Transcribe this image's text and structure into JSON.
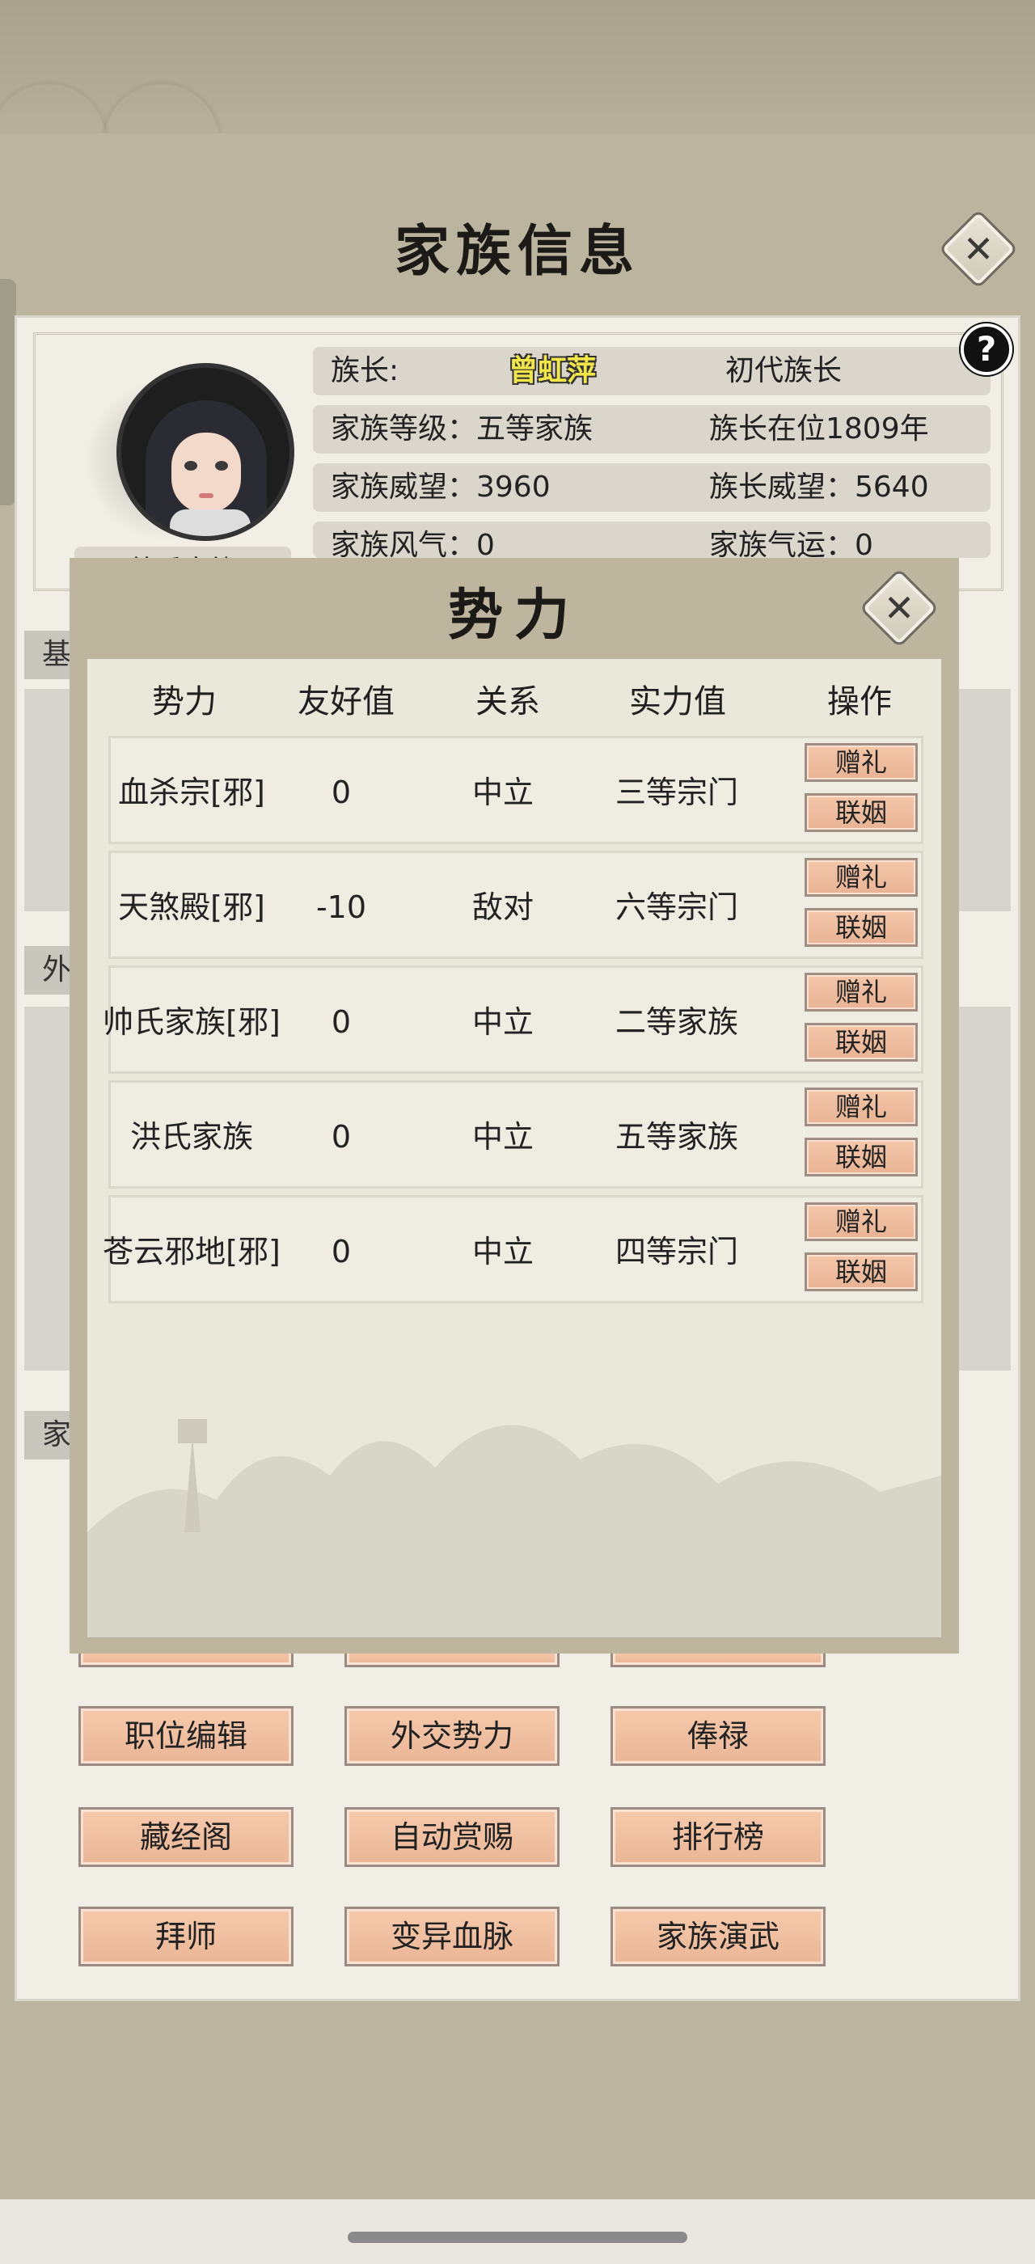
{
  "page": {
    "title": "家族信息",
    "close_icon": "close-icon"
  },
  "family": {
    "chief_label": "族长:",
    "chief_name": "曾虹萍",
    "chief_generation": "初代族长",
    "level": "家族等级：五等家族",
    "tenure": "族长在位1809年",
    "family_prestige": "家族威望：3960",
    "chief_prestige": "族长威望：5640",
    "family_style": "家族风气：0",
    "family_fortune": "家族气运：0",
    "name_plate": "曾氏家族",
    "help_label": "?"
  },
  "sections": {
    "basic": "基",
    "diplomacy": "外",
    "family": "家"
  },
  "functions": {
    "row1": [
      "职位编辑",
      "外交势力",
      "俸禄"
    ],
    "row2": [
      "藏经阁",
      "自动赏赐",
      "排行榜"
    ],
    "row3": [
      "拜师",
      "变异血脉",
      "家族演武"
    ]
  },
  "faction_dialog": {
    "title": "势力",
    "headers": [
      "势力",
      "友好值",
      "关系",
      "实力值",
      "操作"
    ],
    "gift_label": "赠礼",
    "marriage_label": "联姻",
    "rows": [
      {
        "name": "血杀宗[邪]",
        "friendship": "0",
        "relation": "中立",
        "strength": "三等宗门"
      },
      {
        "name": "天煞殿[邪]",
        "friendship": "-10",
        "relation": "敌对",
        "strength": "六等宗门"
      },
      {
        "name": "帅氏家族[邪]",
        "friendship": "0",
        "relation": "中立",
        "strength": "二等家族"
      },
      {
        "name": "洪氏家族",
        "friendship": "0",
        "relation": "中立",
        "strength": "五等家族"
      },
      {
        "name": "苍云邪地[邪]",
        "friendship": "0",
        "relation": "中立",
        "strength": "四等宗门"
      }
    ]
  },
  "colors": {
    "parchment": "#bbb49e",
    "button_fill": "#f4c6a8",
    "chief_name": "#f2e64a"
  }
}
